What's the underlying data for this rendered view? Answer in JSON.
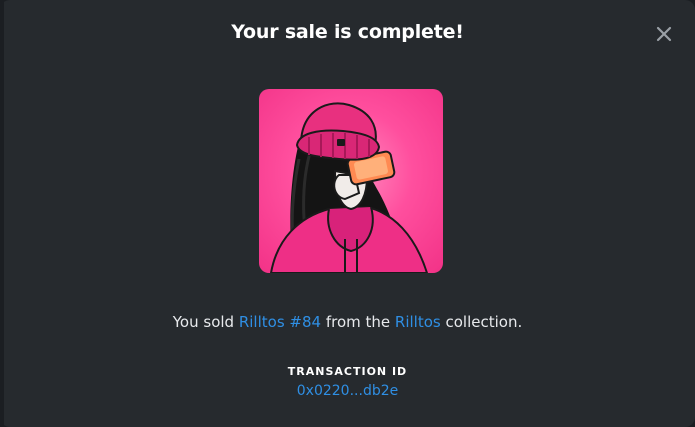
{
  "modal": {
    "title": "Your sale is complete!",
    "close_icon": "close-icon"
  },
  "nft": {
    "image_icon": "nft-artwork"
  },
  "message": {
    "prefix": "You sold ",
    "item_name": "Rilltos #84",
    "middle": " from the ",
    "collection_name": "Rilltos",
    "suffix": " collection."
  },
  "transaction": {
    "label": "TRANSACTION ID",
    "id": "0x0220...db2e"
  },
  "colors": {
    "modal_bg": "#262a2e",
    "accent_link": "#2f8fe4",
    "nft_bg": "#ff4f9e"
  }
}
